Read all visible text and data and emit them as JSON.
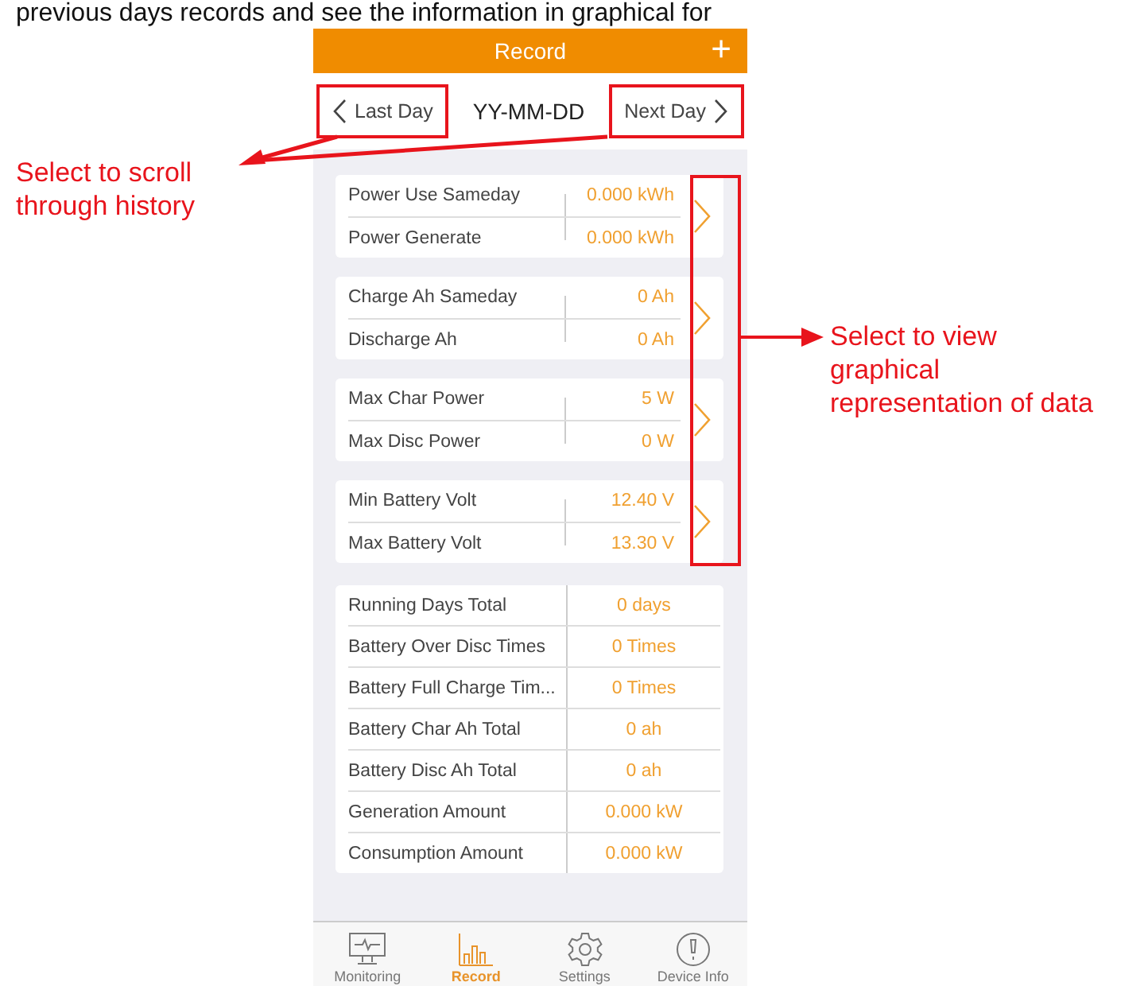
{
  "caption": "previous days records and see the information in graphical for",
  "header": {
    "title": "Record",
    "action": "+"
  },
  "date_nav": {
    "prev": "Last Day",
    "date": "YY-MM-DD",
    "next": "Next Day"
  },
  "groups": [
    {
      "rows": [
        {
          "label": "Power Use Sameday",
          "value": "0.000 kWh"
        },
        {
          "label": "Power Generate",
          "value": "0.000 kWh"
        }
      ]
    },
    {
      "rows": [
        {
          "label": "Charge Ah Sameday",
          "value": "0 Ah"
        },
        {
          "label": "Discharge Ah",
          "value": "0 Ah"
        }
      ]
    },
    {
      "rows": [
        {
          "label": "Max Char Power",
          "value": "5 W"
        },
        {
          "label": "Max Disc Power",
          "value": "0 W"
        }
      ]
    },
    {
      "rows": [
        {
          "label": "Min Battery Volt",
          "value": "12.40 V"
        },
        {
          "label": "Max Battery Volt",
          "value": "13.30 V"
        }
      ]
    }
  ],
  "totals": [
    {
      "label": "Running Days Total",
      "value": "0 days"
    },
    {
      "label": "Battery Over Disc Times",
      "value": "0 Times"
    },
    {
      "label": "Battery Full Charge Tim...",
      "value": "0 Times"
    },
    {
      "label": "Battery Char Ah Total",
      "value": "0 ah"
    },
    {
      "label": "Battery Disc Ah Total",
      "value": "0 ah"
    },
    {
      "label": "Generation Amount",
      "value": "0.000 kW"
    },
    {
      "label": "Consumption Amount",
      "value": "0.000 kW"
    }
  ],
  "tabs": [
    {
      "label": "Monitoring",
      "selected": false
    },
    {
      "label": "Record",
      "selected": true
    },
    {
      "label": "Settings",
      "selected": false
    },
    {
      "label": "Device Info",
      "selected": false
    }
  ],
  "annotations": [
    {
      "text": "Select to scroll through history"
    },
    {
      "text": "Select to view graphical representation of data"
    }
  ]
}
